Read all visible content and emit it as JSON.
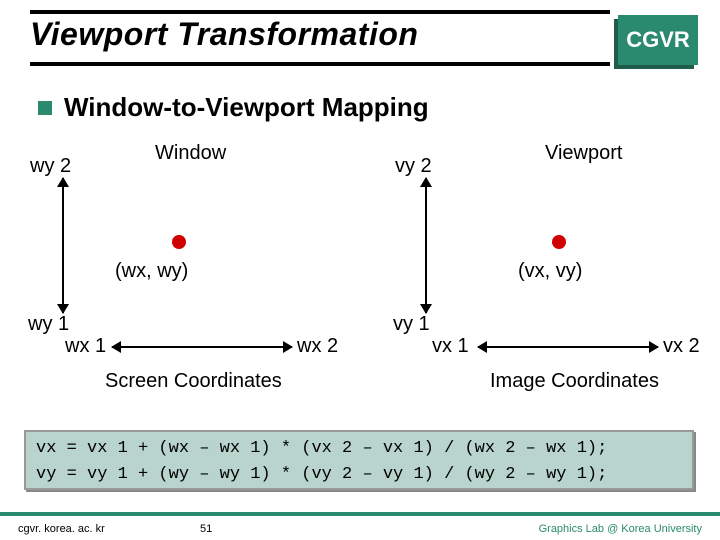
{
  "slide": {
    "title": "Viewport Transformation",
    "logo": "CGVR",
    "section": "Window-to-Viewport Mapping"
  },
  "window": {
    "label": "Window",
    "y_top": "wy 2",
    "y_bot": "wy 1",
    "x_left": "wx 1",
    "x_right": "wx 2",
    "point": "(wx, wy)",
    "caption": "Screen Coordinates"
  },
  "viewport": {
    "label": "Viewport",
    "y_top": "vy 2",
    "y_bot": "vy 1",
    "x_left": "vx 1",
    "x_right": "vx 2",
    "point": "(vx, vy)",
    "caption": "Image Coordinates"
  },
  "formulas": {
    "vx": "vx = vx 1 + (wx – wx 1) * (vx 2 – vx 1) / (wx 2 – wx 1);",
    "vy": "vy = vy 1 + (wy – wy 1) * (vy 2 – vy 1) / (wy 2 – wy 1);"
  },
  "footer": {
    "left": "cgvr. korea. ac. kr",
    "page": "51",
    "right": "Graphics Lab @ Korea University"
  }
}
